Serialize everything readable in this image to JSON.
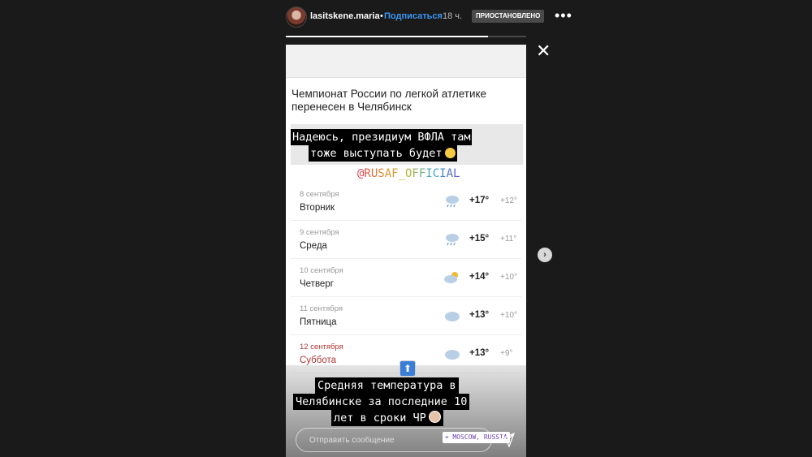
{
  "header": {
    "username": "lasitskene.maria",
    "separator": "•",
    "subscribe_label": "Подписаться",
    "time": "18 ч.",
    "paused_label": "ПРИОСТАНОВЛЕНО",
    "more_icon": "more-dots-icon"
  },
  "progress": {
    "fraction": 0.84
  },
  "close_icon": "close-icon",
  "next_icon": "chevron-right-icon",
  "story": {
    "headline": "Чемпионат России по легкой атлетике перенесен в Челябинск",
    "caption1_line1": "Надеюсь, президиум ВФЛА там",
    "caption1_line2": "тоже выступать будет",
    "mention": "@RUSAF_OFFICIAL",
    "forecast": [
      {
        "date": "8 сентября",
        "day": "Вторник",
        "icon": "rain-icon",
        "high": "+17°",
        "low": "+12°"
      },
      {
        "date": "9 сентября",
        "day": "Среда",
        "icon": "rain-icon",
        "high": "+15°",
        "low": "+11°"
      },
      {
        "date": "10 сентября",
        "day": "Четверг",
        "icon": "partly-sunny-icon",
        "high": "+14°",
        "low": "+10°"
      },
      {
        "date": "11 сентября",
        "day": "Пятница",
        "icon": "cloudy-icon",
        "high": "+13°",
        "low": "+10°"
      },
      {
        "date": "12 сентября",
        "day": "Суббота",
        "icon": "cloudy-icon",
        "high": "+13°",
        "low": "+9°"
      }
    ],
    "up_arrow_icon": "up-arrow-icon",
    "caption2_line1": "Средняя температура в",
    "caption2_line2": "Челябинске за последние 10",
    "caption2_line3": "лет в сроки ЧР",
    "message_placeholder": "Отправить сообщение",
    "location": "MOSCOW, RUSSIA",
    "send_icon": "send-icon"
  },
  "colors": {
    "accent_blue": "#3897f0",
    "weekend_red": "#b33434",
    "background": "#1a1a1a"
  }
}
